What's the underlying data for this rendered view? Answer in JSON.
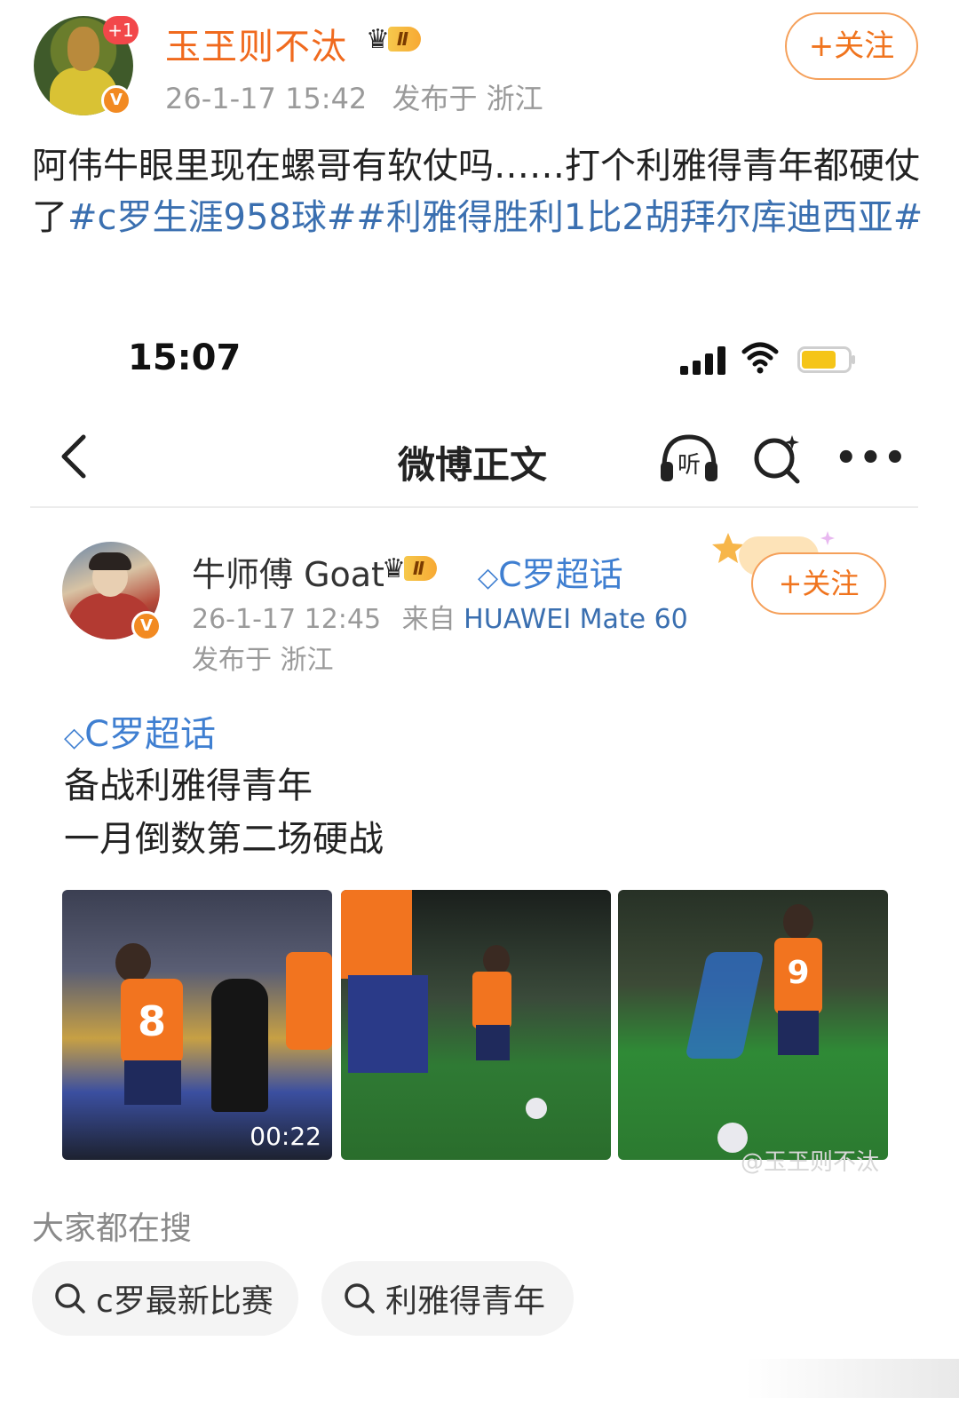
{
  "post": {
    "author_name": "玉玊则不汰",
    "notif_badge": "+1",
    "level_badge": "Ⅱ",
    "timestamp": "26-1-17 15:42",
    "location": "发布于 浙江",
    "follow_label": "+关注",
    "text_plain": "阿伟牛眼里现在螺哥有软仗吗……打个利雅得青年都硬仗了",
    "hashtag_1": "#c罗生涯958球#",
    "hashtag_2": "#利雅得胜利1比2胡拜尔库迪西亚#"
  },
  "embedded": {
    "status_time": "15:07",
    "nav_title": "微博正文",
    "author_name": "牛师傅 Goat",
    "level_badge": "Ⅱ",
    "super_topic": "C罗超话",
    "timestamp": "26-1-17 12:45",
    "source_prefix": "来自",
    "device": "HUAWEI Mate 60",
    "location": "发布于 浙江",
    "follow_label": "+关注",
    "topic_line": "C罗超话",
    "text_line1": "备战利雅得青年",
    "text_line2": "一月倒数第二场硬战",
    "video_duration": "00:22",
    "image_watermark": "@玉玊则不汰",
    "photos": [
      {
        "bib_number": "8"
      },
      {
        "bib_number": ""
      },
      {
        "bib_number": "9"
      }
    ]
  },
  "hot_search": {
    "title": "大家都在搜",
    "chips": [
      "c罗最新比赛",
      "利雅得青年"
    ]
  },
  "colors": {
    "accent_orange": "#f06a1e",
    "link_blue": "#3a6fb0",
    "topic_blue": "#3f7fd1",
    "meta_gray": "#9a9a9a"
  },
  "icons": {
    "back": "chevron-left-icon",
    "listen": "headphones-listen-icon",
    "search": "search-sparkle-icon",
    "more": "more-dots-icon",
    "chip_search": "search-icon"
  }
}
